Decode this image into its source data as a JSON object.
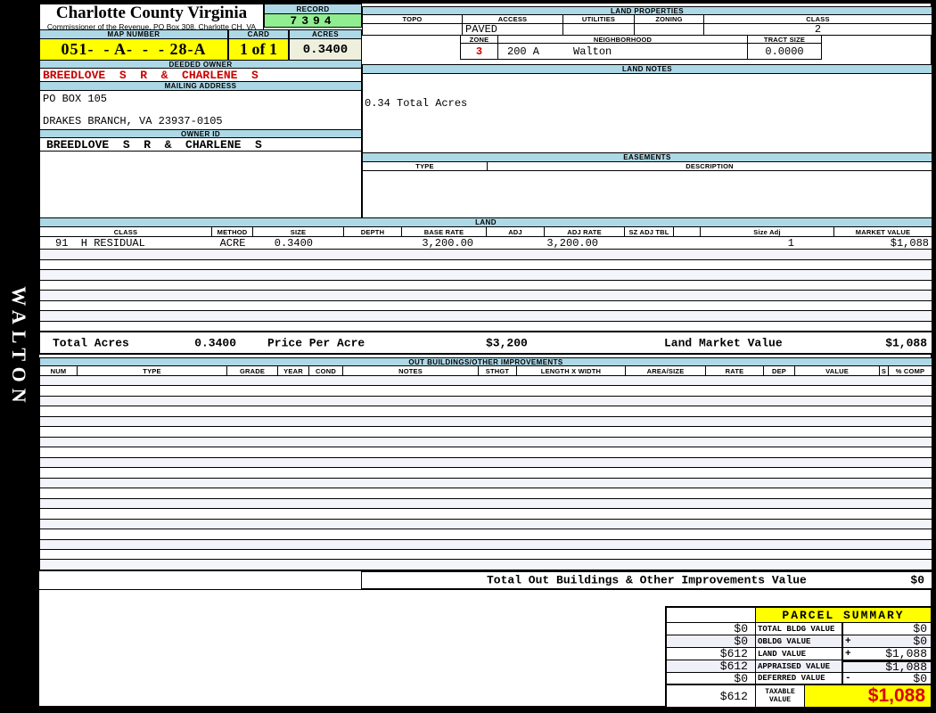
{
  "sidebar": {
    "district": "WALTON"
  },
  "header": {
    "county": "Charlotte County Virginia",
    "commissioner": "Commissioner of the Revenue, PO Box 308, Charlotte CH, VA",
    "record_label": "RECORD",
    "record_value": "7394",
    "map_number_label": "MAP NUMBER",
    "map_number": "051-  - A-  -  - 28-A",
    "card_label": "CARD",
    "card_value": "1 of 1",
    "acres_label": "ACRES",
    "acres_value": "0.3400"
  },
  "owner": {
    "deeded_owner_label": "DEEDED OWNER",
    "deeded_owner": "BREEDLOVE  S  R  &  CHARLENE  S",
    "mailing_address_label": "MAILING ADDRESS",
    "address_line1": "PO BOX 105",
    "address_line2": "DRAKES BRANCH, VA 23937-0105",
    "owner_id_label": "OWNER ID",
    "owner_id": "BREEDLOVE  S  R  &  CHARLENE  S"
  },
  "land_properties": {
    "title": "LAND PROPERTIES",
    "columns": [
      "TOPO",
      "ACCESS",
      "UTILITIES",
      "ZONING",
      "CLASS"
    ],
    "access_value": "PAVED",
    "class_value": "2",
    "zone_label": "ZONE",
    "zone_value": "3",
    "neighborhood_label": "NEIGHBORHOOD",
    "neighborhood_code": "200 A",
    "neighborhood_name": "Walton",
    "tract_size_label": "TRACT SIZE",
    "tract_size_value": "0.0000"
  },
  "land_notes": {
    "title": "LAND NOTES",
    "note": "0.34 Total Acres"
  },
  "easements": {
    "title": "EASEMENTS",
    "type_label": "TYPE",
    "description_label": "DESCRIPTION"
  },
  "land": {
    "title": "LAND",
    "columns": [
      "CLASS",
      "METHOD",
      "SIZE",
      "DEPTH",
      "BASE RATE",
      "ADJ",
      "ADJ RATE",
      "SZ ADJ TBL",
      "",
      "Size Adj",
      "MARKET VALUE"
    ],
    "rows": [
      [
        "91  H RESIDUAL",
        "ACRE",
        "0.3400",
        "",
        "3,200.00",
        "",
        "3,200.00",
        "",
        "",
        "1",
        "$1,088"
      ]
    ],
    "empty_rows": 8,
    "totals": {
      "total_acres_label": "Total Acres",
      "total_acres_value": "0.3400",
      "price_per_acre_label": "Price Per Acre",
      "price_per_acre_value": "$3,200",
      "land_market_value_label": "Land Market Value",
      "land_market_value": "$1,088"
    }
  },
  "out_buildings": {
    "title": "OUT BUILDINGS/OTHER IMPROVEMENTS",
    "columns": [
      "NUM",
      "TYPE",
      "GRADE",
      "YEAR",
      "COND",
      "NOTES",
      "STHGT",
      "LENGTH X WIDTH",
      "AREA/SIZE",
      "RATE",
      "DEP",
      "VALUE",
      "S",
      "% COMP"
    ],
    "empty_rows": 19,
    "total_label": "Total Out Buildings & Other Improvements Value",
    "total_value": "$0"
  },
  "parcel_summary": {
    "title": "PARCEL SUMMARY",
    "rows": [
      {
        "prior": "$0",
        "label": "TOTAL BLDG VALUE",
        "op": "",
        "value": "$0"
      },
      {
        "prior": "$0",
        "label": "OBLDG VALUE",
        "op": "+",
        "value": "$0"
      },
      {
        "prior": "$612",
        "label": "LAND VALUE",
        "op": "+",
        "value": "$1,088"
      },
      {
        "prior": "$612",
        "label": "APPRAISED VALUE",
        "op": "",
        "value": "$1,088"
      },
      {
        "prior": "$0",
        "label": "DEFERRED VALUE",
        "op": "-",
        "value": "$0"
      }
    ],
    "taxable": {
      "prior": "$612",
      "label": "TAXABLE VALUE",
      "value": "$1,088"
    }
  },
  "colors": {
    "header_blue": "#ADD8E6",
    "record_green": "#90EE90",
    "highlight_yellow": "#FFFF00",
    "acres_ivory": "#EFEFDE",
    "alert_red": "#CC0000",
    "row_stripe": "#F4F4FB"
  }
}
